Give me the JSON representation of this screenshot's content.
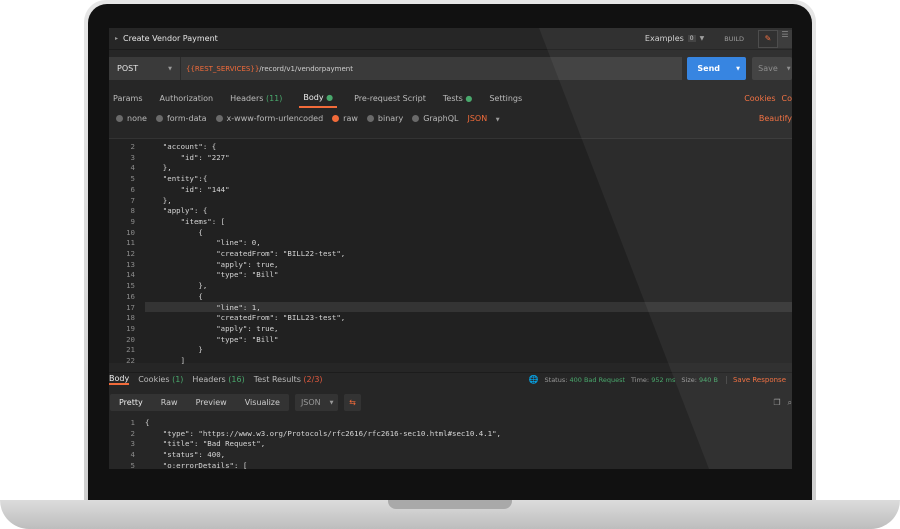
{
  "request": {
    "name": "Create Vendor Payment",
    "examples_label": "Examples",
    "examples_count": "0",
    "build_label": "BUILD",
    "method": "POST",
    "url_var": "{{REST_SERVICES}}",
    "url_path": "/record/v1/vendorpayment",
    "send": "Send",
    "save": "Save"
  },
  "req_tabs": {
    "params": "Params",
    "auth": "Authorization",
    "headers": "Headers",
    "headers_count": "(11)",
    "body": "Body",
    "prerequest": "Pre-request Script",
    "tests": "Tests",
    "settings": "Settings",
    "cookies": "Cookies",
    "code": "Co"
  },
  "body_types": {
    "none": "none",
    "form_data": "form-data",
    "urlencoded": "x-www-form-urlencoded",
    "raw": "raw",
    "binary": "binary",
    "graphql": "GraphQL",
    "format": "JSON",
    "beautify": "Beautify"
  },
  "request_body": [
    {
      "n": "2",
      "t": "    \"account\": {"
    },
    {
      "n": "3",
      "t": "        \"id\": \"227\""
    },
    {
      "n": "4",
      "t": "    },"
    },
    {
      "n": "5",
      "t": "    \"entity\":{"
    },
    {
      "n": "6",
      "t": "        \"id\": \"144\""
    },
    {
      "n": "7",
      "t": "    },"
    },
    {
      "n": "8",
      "t": "    \"apply\": {"
    },
    {
      "n": "9",
      "t": "        \"items\": ["
    },
    {
      "n": "10",
      "t": "            {"
    },
    {
      "n": "11",
      "t": "                \"line\": 0,"
    },
    {
      "n": "12",
      "t": "                \"createdFrom\": \"BILL22-test\","
    },
    {
      "n": "13",
      "t": "                \"apply\": true,"
    },
    {
      "n": "14",
      "t": "                \"type\": \"Bill\""
    },
    {
      "n": "15",
      "t": "            },"
    },
    {
      "n": "16",
      "t": "            {"
    },
    {
      "n": "17",
      "t": "                \"line\": 1,"
    },
    {
      "n": "18",
      "t": "                \"createdFrom\": \"BILL23-test\","
    },
    {
      "n": "19",
      "t": "                \"apply\": true,"
    },
    {
      "n": "20",
      "t": "                \"type\": \"Bill\""
    },
    {
      "n": "21",
      "t": "            }"
    },
    {
      "n": "22",
      "t": "        ]"
    }
  ],
  "response": {
    "body": "Body",
    "cookies": "Cookies",
    "cookies_count": "(1)",
    "headers": "Headers",
    "headers_count": "(16)",
    "tests": "Test Results",
    "tests_count": "(2/3)",
    "status_label": "Status:",
    "status": "400 Bad Request",
    "time_label": "Time:",
    "time": "952 ms",
    "size_label": "Size:",
    "size": "940 B",
    "save": "Save Response",
    "views": [
      "Pretty",
      "Raw",
      "Preview",
      "Visualize"
    ],
    "format": "JSON"
  },
  "response_body": [
    {
      "n": "1",
      "t": "{"
    },
    {
      "n": "2",
      "t": "    \"type\": \"https://www.w3.org/Protocols/rfc2616/rfc2616-sec10.html#sec10.4.1\","
    },
    {
      "n": "3",
      "t": "    \"title\": \"Bad Request\","
    },
    {
      "n": "4",
      "t": "    \"status\": 400,"
    },
    {
      "n": "5",
      "t": "    \"o:errorDetails\": ["
    }
  ],
  "colors": {
    "accent": "#f26b3a",
    "send": "#2d7fe0",
    "success": "#49a86c",
    "error": "#e0593e"
  }
}
